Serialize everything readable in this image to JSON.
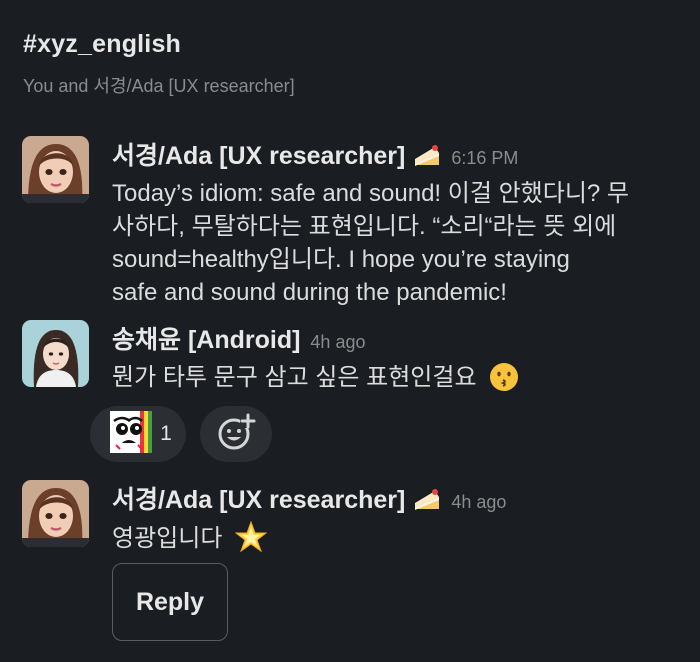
{
  "channel": {
    "name": "#xyz_english",
    "members": "You and 서경/Ada [UX researcher]"
  },
  "messages": [
    {
      "author": "서경/Ada [UX researcher]",
      "status_emoji": "cake-emoji",
      "time": "6:16 PM",
      "lines": [
        "Today’s idiom: safe and sound! 이걸 안했다니? 무",
        "사하다, 무탈하다는 표현입니다. “소리“라는 뜻 외에",
        "sound=healthy입니다. I hope you’re staying",
        "safe and sound during the pandemic!"
      ]
    },
    {
      "author": "송채윤 [Android]",
      "time": "4h ago",
      "text": "뭔가 타투 문구 삼고 싶은 표현인걸요",
      "emoji": "kissing-face-emoji"
    },
    {
      "author": "서경/Ada [UX researcher]",
      "status_emoji": "cake-emoji",
      "time": "4h ago",
      "text": "영광입니다",
      "emoji": "glowing-star-emoji"
    }
  ],
  "reactions": [
    {
      "emoji": "custom-rainbow-face-emoji",
      "count": "1"
    }
  ],
  "add_reaction_icon": "add-reaction-icon",
  "reply_button": "Reply"
}
